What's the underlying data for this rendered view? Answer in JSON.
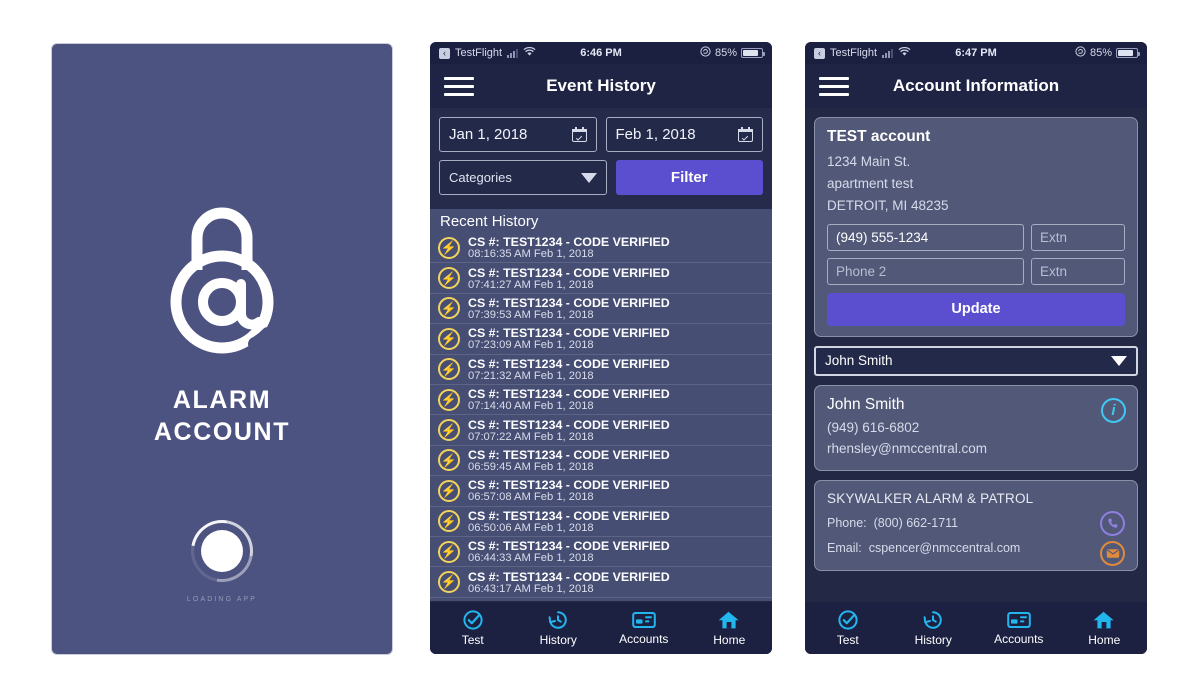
{
  "splash": {
    "logo_icon": "padlock-at-logo",
    "brand_line1": "ALARM",
    "brand_line2": "ACCOUNT",
    "loader_icon": "loading-spinner",
    "loading_label": "LOADING APP"
  },
  "status_bar_history": {
    "back_icon": "back-chevron-icon",
    "carrier": "TestFlight",
    "signal_icon": "cellular-signal-icon",
    "wifi_icon": "wifi-icon",
    "time": "6:46 PM",
    "lock_icon": "rotation-lock-icon",
    "battery_pct": "85%",
    "battery_icon": "battery-icon"
  },
  "status_bar_account": {
    "back_icon": "back-chevron-icon",
    "carrier": "TestFlight",
    "signal_icon": "cellular-signal-icon",
    "wifi_icon": "wifi-icon",
    "time": "6:47 PM",
    "lock_icon": "rotation-lock-icon",
    "battery_pct": "85%",
    "battery_icon": "battery-icon"
  },
  "history": {
    "nav_title": "Event History",
    "menu_icon": "hamburger-menu-icon",
    "filters": {
      "start_date": "Jan 1, 2018",
      "end_date": "Feb 1, 2018",
      "calendar_icon": "calendar-icon",
      "categories_label": "Categories",
      "dropdown_icon": "chevron-down-icon",
      "filter_button": "Filter"
    },
    "section_header": "Recent History",
    "row_icon": "lightning-bolt-icon",
    "items": [
      {
        "title": "CS #: TEST1234 - CODE VERIFIED",
        "time": "08:16:35 AM Feb 1, 2018"
      },
      {
        "title": "CS #: TEST1234 - CODE VERIFIED",
        "time": "07:41:27 AM Feb 1, 2018"
      },
      {
        "title": "CS #: TEST1234 - CODE VERIFIED",
        "time": "07:39:53 AM Feb 1, 2018"
      },
      {
        "title": "CS #: TEST1234 - CODE VERIFIED",
        "time": "07:23:09 AM Feb 1, 2018"
      },
      {
        "title": "CS #: TEST1234 - CODE VERIFIED",
        "time": "07:21:32 AM Feb 1, 2018"
      },
      {
        "title": "CS #: TEST1234 - CODE VERIFIED",
        "time": "07:14:40 AM Feb 1, 2018"
      },
      {
        "title": "CS #: TEST1234 - CODE VERIFIED",
        "time": "07:07:22 AM Feb 1, 2018"
      },
      {
        "title": "CS #: TEST1234 - CODE VERIFIED",
        "time": "06:59:45 AM Feb 1, 2018"
      },
      {
        "title": "CS #: TEST1234 - CODE VERIFIED",
        "time": "06:57:08 AM Feb 1, 2018"
      },
      {
        "title": "CS #: TEST1234 - CODE VERIFIED",
        "time": "06:50:06 AM Feb 1, 2018"
      },
      {
        "title": "CS #: TEST1234 - CODE VERIFIED",
        "time": "06:44:33 AM Feb 1, 2018"
      },
      {
        "title": "CS #: TEST1234 - CODE VERIFIED",
        "time": "06:43:17 AM Feb 1, 2018"
      }
    ]
  },
  "account": {
    "nav_title": "Account Information",
    "menu_icon": "hamburger-menu-icon",
    "account_card": {
      "name": "TEST account",
      "address1": "1234 Main St.",
      "address2": "apartment test",
      "city_state_zip": "DETROIT, MI 48235",
      "phone1_value": "(949) 555-1234",
      "extn1_placeholder": "Extn",
      "phone2_placeholder": "Phone 2",
      "extn2_placeholder": "Extn",
      "update_button": "Update"
    },
    "contact_select": {
      "selected": "John Smith",
      "dropdown_icon": "chevron-down-icon"
    },
    "contact_card": {
      "name": "John Smith",
      "phone": "(949) 616-6802",
      "email": "rhensley@nmccentral.com",
      "info_icon": "info-icon"
    },
    "dealer_card": {
      "name": "SKYWALKER ALARM & PATROL",
      "phone_label": "Phone:",
      "phone_value": "(800) 662-1711",
      "email_label": "Email:",
      "email_value": "cspencer@nmccentral.com",
      "call_icon": "phone-icon",
      "mail_icon": "envelope-icon"
    }
  },
  "tabbar": {
    "items": [
      {
        "label": "Test",
        "icon": "check-circle-icon"
      },
      {
        "label": "History",
        "icon": "clock-rewind-icon"
      },
      {
        "label": "Accounts",
        "icon": "card-icon"
      },
      {
        "label": "Home",
        "icon": "house-icon"
      }
    ]
  },
  "colors": {
    "splash_bg": "#4d5381",
    "dark_navy": "#232845",
    "nav_bg": "#1f2444",
    "list_bg": "#474e74",
    "card_bg": "#515878",
    "accent_purple": "#5b4fcf",
    "tab_cyan": "#22b6ef",
    "bolt_gold": "#f2d45c",
    "info_cyan": "#3fc8f4",
    "mail_orange": "#e08a3c"
  }
}
